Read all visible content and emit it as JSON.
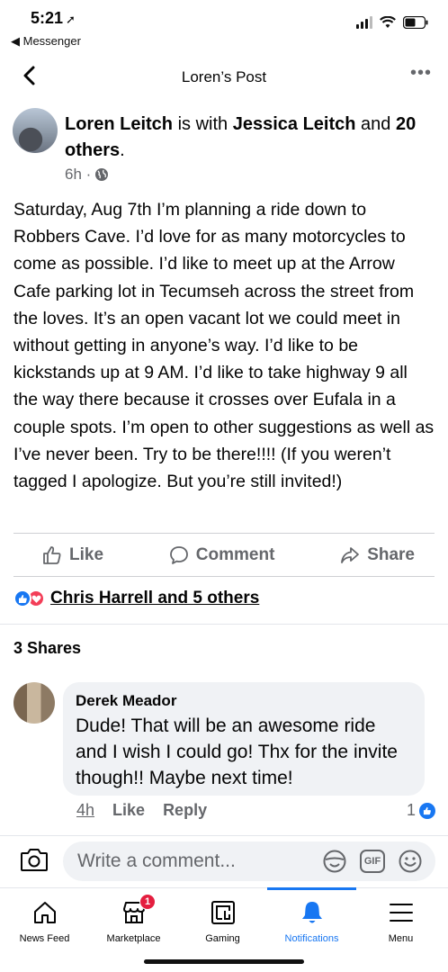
{
  "status_bar": {
    "time": "5:21",
    "back_app": "Messenger"
  },
  "nav": {
    "title": "Loren’s Post"
  },
  "post": {
    "author": "Loren Leitch",
    "with_text": "is with",
    "tagged": "Jessica Leitch",
    "and_text": "and",
    "others": "20 others",
    "time": "6h ·",
    "body": "Saturday, Aug 7th I’m planning a ride down to Robbers Cave. I’d love for as many motorcycles to come as possible. I’d like to meet up at the Arrow Cafe parking lot in Tecumseh across the street from the loves. It’s an open vacant lot we could meet in without getting in anyone’s way. I’d like to be kickstands up at 9 AM. I’d like to take highway 9 all the way there because it crosses over Eufala in a couple spots. I’m open to other suggestions as well as I’ve never been. Try to be there!!!! (If you weren’t tagged I apologize. But you’re still invited!)"
  },
  "actions": {
    "like": "Like",
    "comment": "Comment",
    "share": "Share"
  },
  "reactions": {
    "text": "Chris Harrell and 5 others"
  },
  "shares": "3 Shares",
  "comment": {
    "author": "Derek Meador",
    "text": "Dude! That will be an awesome ride and I wish I could go! Thx for the invite though!! Maybe next time!",
    "time": "4h",
    "like": "Like",
    "reply": "Reply",
    "like_count": "1"
  },
  "composer": {
    "placeholder": "Write a comment...",
    "gif_label": "GIF"
  },
  "tabs": [
    {
      "label": "News Feed",
      "icon": "home-icon"
    },
    {
      "label": "Marketplace",
      "icon": "marketplace-icon",
      "badge": "1"
    },
    {
      "label": "Gaming",
      "icon": "gaming-icon"
    },
    {
      "label": "Notifications",
      "icon": "bell-icon",
      "active": true
    },
    {
      "label": "Menu",
      "icon": "menu-icon"
    }
  ],
  "colors": {
    "accent": "#1877f2",
    "secondary_text": "#65676b",
    "bubble": "#f0f2f5",
    "love": "#f33e58",
    "badge": "#e41e3f"
  }
}
